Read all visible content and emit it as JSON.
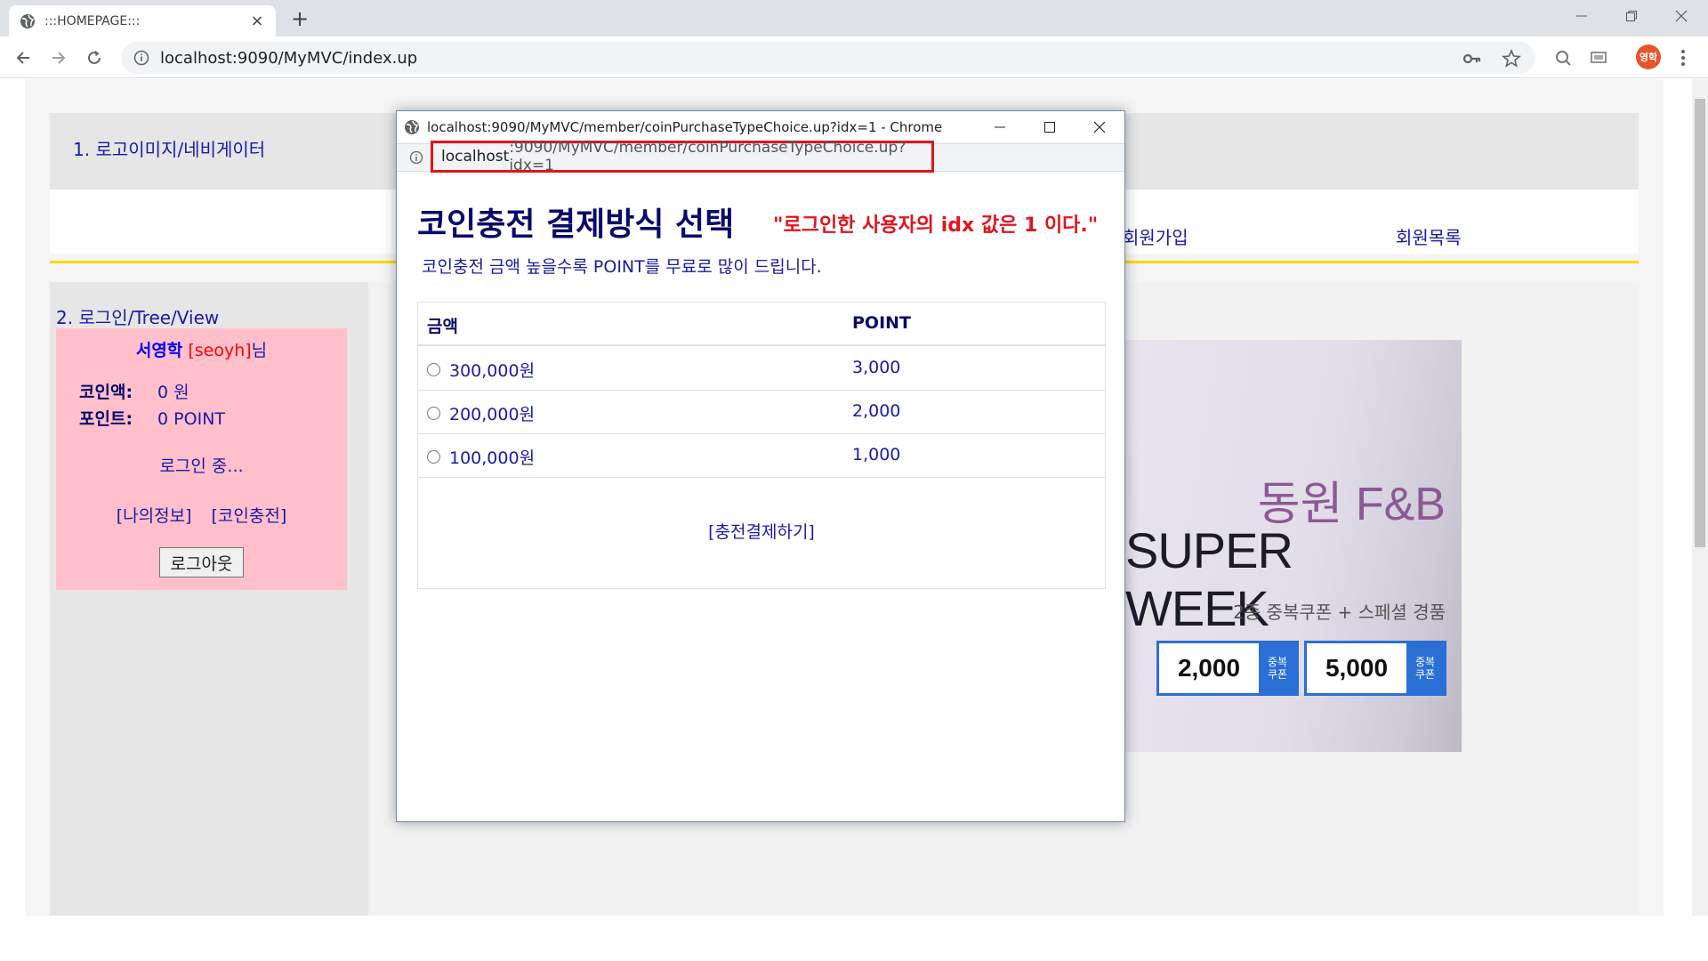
{
  "browser": {
    "tab_title": ":::HOMEPAGE:::",
    "tab_close": "×",
    "new_tab": "+",
    "url": "localhost:9090/MyMVC/index.up",
    "profile_initials": "영학"
  },
  "page": {
    "header_text": "1. 로고이미지/네비게이터",
    "menu": [
      "회원가입",
      "회원목록"
    ],
    "sidebar_title": "2. 로그인/Tree/View",
    "login": {
      "name": "서영학",
      "userid": "[seoyh]",
      "suffix": "님",
      "coin_label": "코인액:",
      "coin_value": "0 원",
      "point_label": "포인트:",
      "point_value": "0 POINT",
      "status": "로그인 중...",
      "link_myinfo": "[나의정보]",
      "link_coin": "[코인충전]",
      "logout": "로그아웃"
    },
    "banner": {
      "brand": "동원 F&B",
      "headline": "SUPER WEEK",
      "subtitle": "2종 중복쿠폰 + 스페셜 경품",
      "coupons": [
        {
          "value": "2,000",
          "tag": "중복\n쿠폰"
        },
        {
          "value": "5,000",
          "tag": "중복\n쿠폰"
        }
      ]
    }
  },
  "popup": {
    "window_title": "localhost:9090/MyMVC/member/coinPurchaseTypeChoice.up?idx=1 - Chrome",
    "url_host": "localhost",
    "url_rest": ":9090/MyMVC/member/coinPurchaseTypeChoice.up?idx=1",
    "title": "코인충전 결제방식 선택",
    "note": "\"로그인한 사용자의 idx 값은 1 이다.\"",
    "subtitle": "코인충전 금액 높을수록 POINT를 무료로 많이 드립니다.",
    "table": {
      "headers": [
        "금액",
        "POINT"
      ],
      "rows": [
        {
          "amount": "300,000원",
          "point": "3,000"
        },
        {
          "amount": "200,000원",
          "point": "2,000"
        },
        {
          "amount": "100,000원",
          "point": "1,000"
        }
      ]
    },
    "pay_link": "[충전결제하기]"
  }
}
